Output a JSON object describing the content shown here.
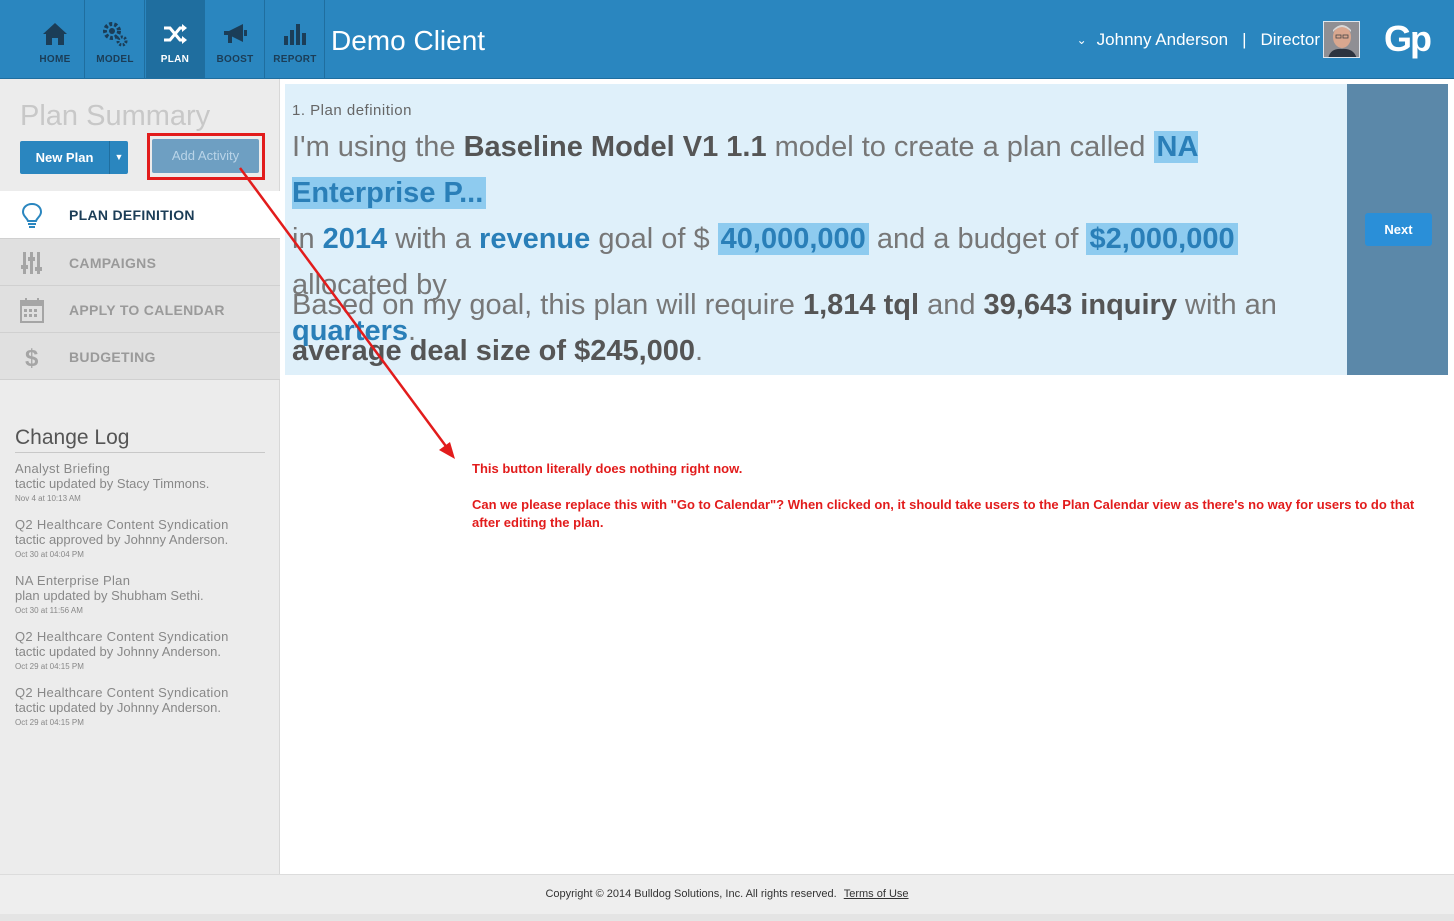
{
  "nav": {
    "items": [
      {
        "label": "HOME",
        "icon": "home-icon"
      },
      {
        "label": "MODEL",
        "icon": "gears-icon"
      },
      {
        "label": "PLAN",
        "icon": "shuffle-icon",
        "active": true
      },
      {
        "label": "BOOST",
        "icon": "megaphone-icon"
      },
      {
        "label": "REPORT",
        "icon": "bar-chart-icon"
      }
    ],
    "client_title": "Demo Client",
    "user_name": "Johnny Anderson",
    "separator": "|",
    "user_role": "Director",
    "logo_text": "Gp"
  },
  "sidebar": {
    "title": "Plan Summary",
    "new_plan_label": "New Plan",
    "add_activity_label": "Add Activity",
    "menu": [
      {
        "label": "PLAN DEFINITION",
        "icon": "lightbulb-icon",
        "active": true
      },
      {
        "label": "CAMPAIGNS",
        "icon": "sliders-icon"
      },
      {
        "label": "APPLY TO CALENDAR",
        "icon": "calendar-icon"
      },
      {
        "label": "BUDGETING",
        "icon": "dollar-icon"
      }
    ],
    "changelog_title": "Change Log",
    "changelog": [
      {
        "name": "Analyst Briefing",
        "desc": "tactic updated by Stacy Timmons.",
        "date": "Nov 4 at 10:13 AM"
      },
      {
        "name": "Q2 Healthcare Content Syndication",
        "desc": "tactic approved by Johnny Anderson.",
        "date": "Oct 30 at 04:04 PM"
      },
      {
        "name": "NA Enterprise Plan",
        "desc": "plan updated by Shubham Sethi.",
        "date": "Oct 30 at 11:56 AM"
      },
      {
        "name": "Q2 Healthcare Content Syndication",
        "desc": "tactic updated by Johnny Anderson.",
        "date": "Oct 29 at 04:15 PM"
      },
      {
        "name": "Q2 Healthcare Content Syndication",
        "desc": "tactic updated by Johnny Anderson.",
        "date": "Oct 29 at 04:15 PM"
      }
    ]
  },
  "main": {
    "step_label": "1. Plan definition",
    "s1_a": "I'm using the ",
    "model_name": "Baseline Model V1 1.1",
    "s1_b": " model to create a plan called ",
    "plan_name": "NA Enterprise P...",
    "s1_c": "in ",
    "year": "2014",
    "s1_d": " with a ",
    "goal_type": "revenue",
    "s1_e": " goal of $ ",
    "goal_value": "40,000,000",
    "s1_f": " and a budget of ",
    "budget_value": "$2,000,000",
    "s1_g": " allocated by ",
    "allocation": "quarters",
    "s1_h": ".",
    "s2_a": "Based on my goal, this plan will require ",
    "tql": "1,814 tql",
    "s2_b": " and ",
    "inquiry": "39,643 inquiry",
    "s2_c": " with an ",
    "deal_size": "average deal size of $245,000",
    "s2_d": ".",
    "next_label": "Next"
  },
  "annotation": {
    "line1": "This button literally does nothing right now.",
    "line2": "Can we please replace this with \"Go to Calendar\"? When clicked on, it should take users to the Plan Calendar view as there's no way for users to do that after editing the plan.",
    "color": "#e21c1c"
  },
  "footer": {
    "copyright": "Copyright © 2014 Bulldog Solutions, Inc. All rights reserved.",
    "terms_label": "Terms of Use"
  }
}
